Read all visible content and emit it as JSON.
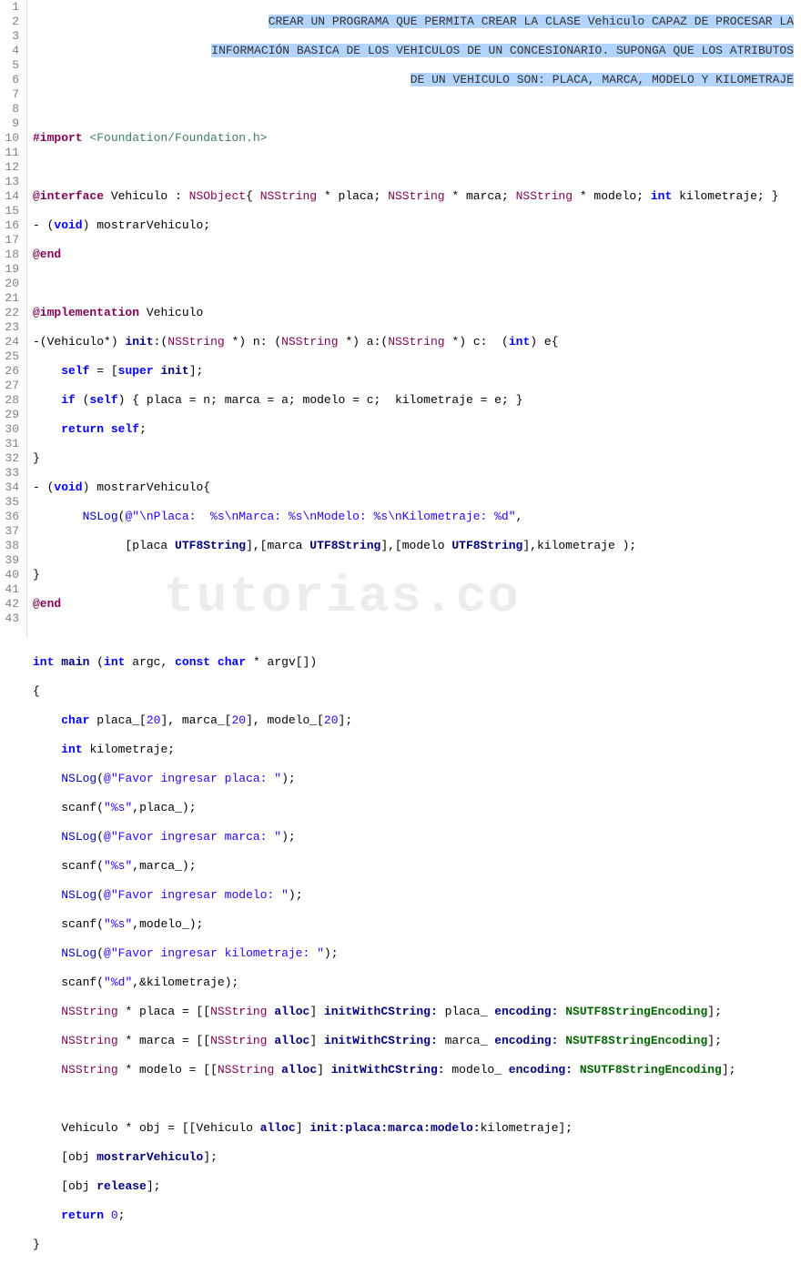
{
  "watermark": "tutorias.co",
  "gutter_start": 1,
  "gutter_end": 43,
  "comment": {
    "l1": "CREAR UN PROGRAMA QUE PERMITA CREAR LA CLASE Vehiculo CAPAZ DE PROCESAR LA",
    "l2": "INFORMACIÓN BASICA DE LOS VEHICULOS DE UN CONCESIONARIO. SUPONGA QUE LOS ATRIBUTOS",
    "l3": "DE UN VEHICULO SON: PLACA, MARCA, MODELO Y KILOMETRAJE"
  },
  "tok": {
    "import": "#import",
    "foundation": "<Foundation/Foundation.h>",
    "interface": "@interface",
    "Vehiculo": "Vehiculo",
    "NSObject": "NSObject",
    "NSString": "NSString",
    "placa": "placa",
    "marca": "marca",
    "modelo": "modelo",
    "kilometraje": "kilometraje",
    "int": "int",
    "void": "void",
    "mostrarVehiculo": "mostrarVehiculo",
    "end": "@end",
    "implementation": "@implementation",
    "init": "init",
    "self": "self",
    "super": "super",
    "if": "if",
    "return": "return",
    "NSLog": "NSLog",
    "fmt1": "@\"\\nPlaca:  %s\\nMarca: %s\\nModelo: %s\\nKilometraje: %d\"",
    "UTF8String": "UTF8String",
    "main": "main",
    "const": "const",
    "char": "char",
    "argc": "argc",
    "argv": "argv[]",
    "placa_arr": "placa_[",
    "marca_arr": "marca_[",
    "modelo_arr": "modelo_[",
    "twenty": "20",
    "str_placa": "@\"Favor ingresar placa: \"",
    "str_marca": "@\"Favor ingresar marca: \"",
    "str_modelo": "@\"Favor ingresar modelo: \"",
    "str_kilo": "@\"Favor ingresar kilometraje: \"",
    "scanf": "scanf",
    "scanf_s": "\"%s\"",
    "scanf_d": "\"%d\"",
    "placa_": "placa_",
    "marca_": "marca_",
    "modelo_": "modelo_",
    "amp_kilo": "&kilometraje",
    "alloc": "alloc",
    "initWithCString": "initWithCString:",
    "encoding": "encoding:",
    "NSUTF8": "NSUTF8StringEncoding",
    "obj": "obj",
    "initchain": "init:placa:marca:modelo:",
    "release": "release",
    "zero": "0",
    "n": "n",
    "a": "a",
    "c": "c",
    "e": "e"
  }
}
